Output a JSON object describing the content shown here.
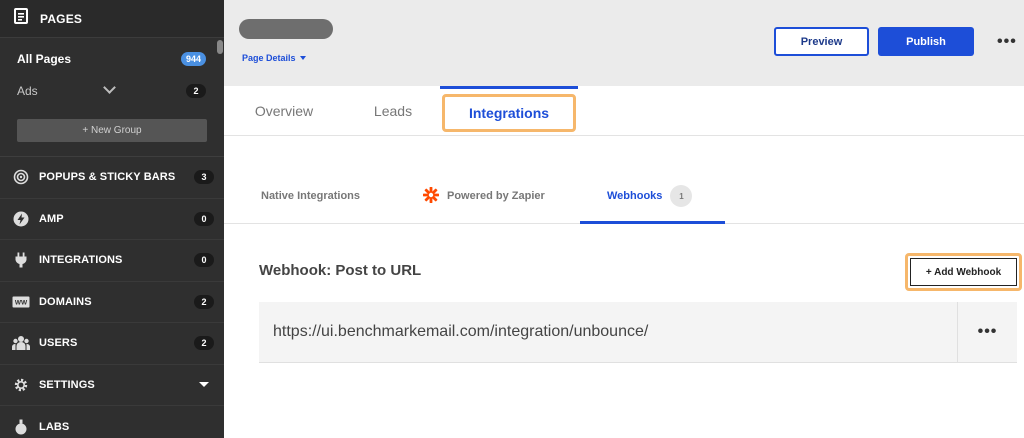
{
  "sidebar": {
    "pages_label": "PAGES",
    "all_pages_label": "All Pages",
    "all_pages_count": "944",
    "ads_label": "Ads",
    "ads_count": "2",
    "new_group_label": "+ New Group",
    "nav": [
      {
        "label": "POPUPS & STICKY BARS",
        "count": "3",
        "icon": "target-icon"
      },
      {
        "label": "AMP",
        "count": "0",
        "icon": "bolt-icon"
      },
      {
        "label": "INTEGRATIONS",
        "count": "0",
        "icon": "plug-icon"
      },
      {
        "label": "DOMAINS",
        "count": "2",
        "icon": "www-icon"
      },
      {
        "label": "USERS",
        "count": "2",
        "icon": "users-icon"
      },
      {
        "label": "SETTINGS",
        "icon": "gear-icon"
      },
      {
        "label": "LABS",
        "icon": "flask-icon"
      }
    ]
  },
  "header": {
    "page_details_label": "Page Details",
    "preview_label": "Preview",
    "publish_label": "Publish",
    "more_label": "•••"
  },
  "tabs": [
    {
      "label": "Overview"
    },
    {
      "label": "Leads"
    },
    {
      "label": "Integrations"
    }
  ],
  "subtabs": {
    "native": "Native Integrations",
    "zapier": "Powered by Zapier",
    "webhooks": "Webhooks",
    "webhooks_count": "1"
  },
  "webhook": {
    "title": "Webhook: Post to URL",
    "add_label": "+ Add Webhook",
    "url": "https://ui.benchmarkemail.com/integration/unbounce/",
    "more_label": "•••"
  },
  "colors": {
    "accent": "#1d4ed8",
    "highlight": "#f6b76b",
    "sidebar_bg": "#2f2f2f",
    "zapier": "#ff4a00"
  }
}
